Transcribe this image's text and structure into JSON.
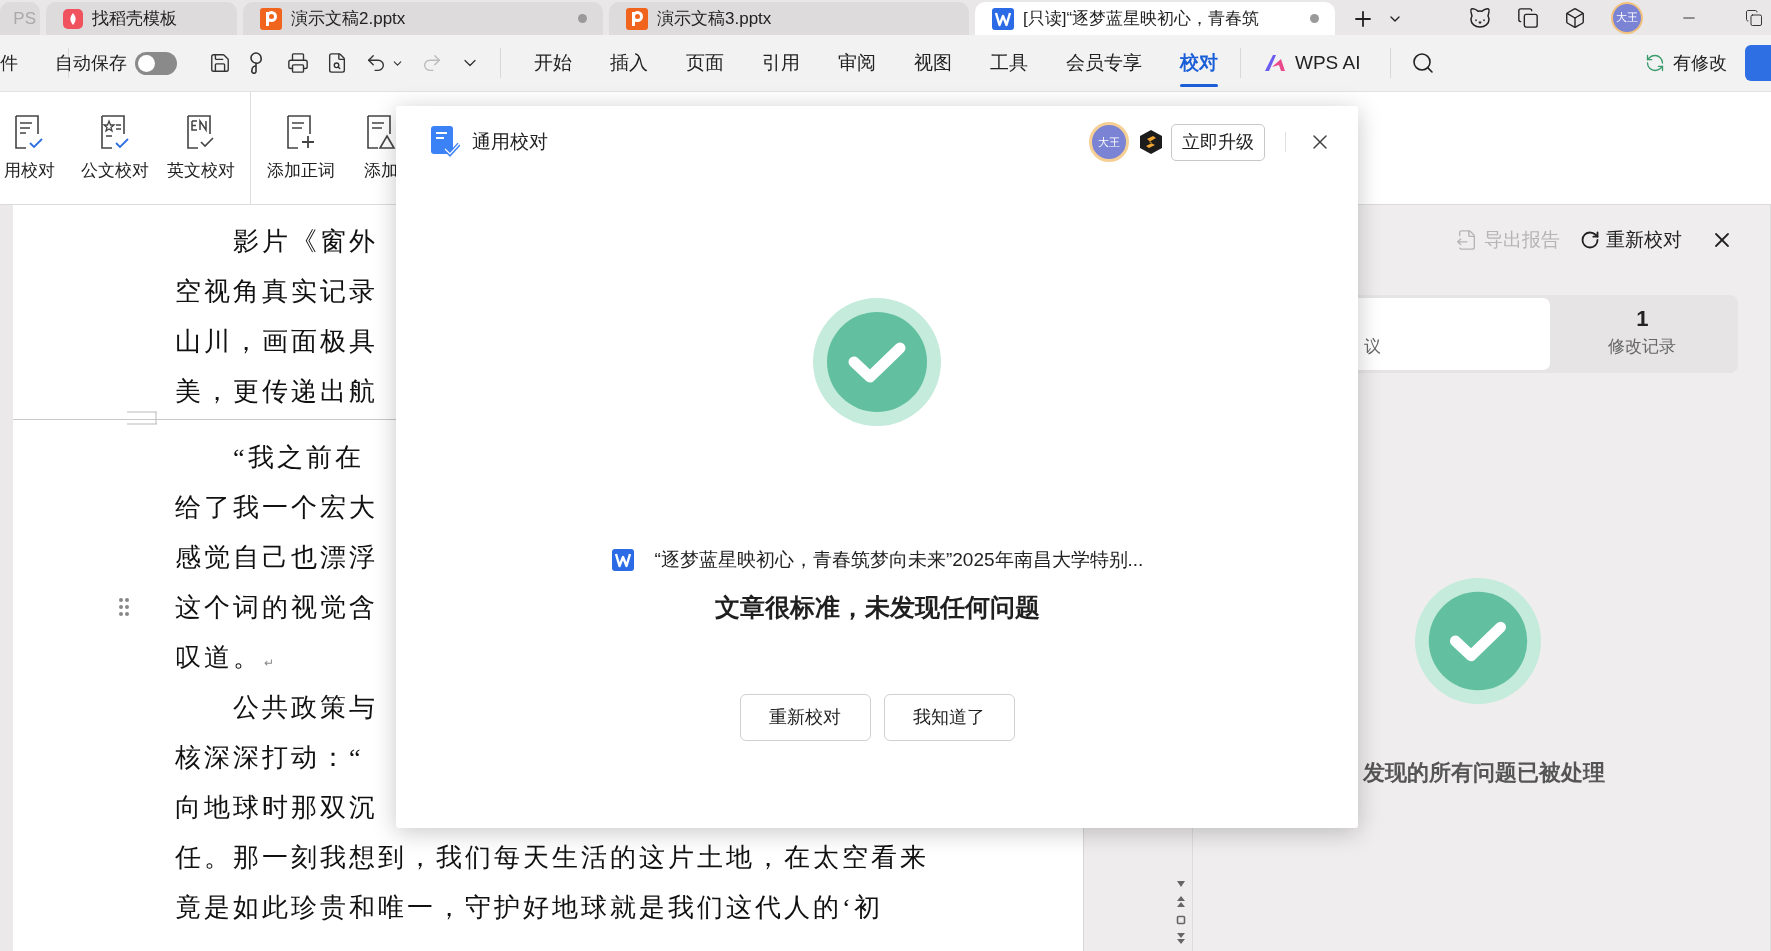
{
  "title_bar": {
    "tabs": [
      {
        "label": "PS",
        "kind": "home",
        "selected": false,
        "unsaved": false
      },
      {
        "label": "找稻壳模板",
        "kind": "template",
        "selected": false,
        "unsaved": false
      },
      {
        "label": "演示文稿2.pptx",
        "kind": "slides",
        "selected": false,
        "unsaved": true
      },
      {
        "label": "演示文稿3.pptx",
        "kind": "slides",
        "selected": false,
        "unsaved": false
      },
      {
        "label": "[只读]“逐梦蓝星映初心，青春筑",
        "kind": "writer",
        "selected": true,
        "unsaved": true
      }
    ],
    "avatar": "大王"
  },
  "toolbar": {
    "file_menu": "件",
    "autosave": {
      "label": "自动保存",
      "on": false
    },
    "menu": [
      {
        "label": "开始",
        "selected": false
      },
      {
        "label": "插入",
        "selected": false
      },
      {
        "label": "页面",
        "selected": false
      },
      {
        "label": "引用",
        "selected": false
      },
      {
        "label": "审阅",
        "selected": false
      },
      {
        "label": "视图",
        "selected": false
      },
      {
        "label": "工具",
        "selected": false
      },
      {
        "label": "会员专享",
        "selected": false
      },
      {
        "label": "校对",
        "selected": true
      }
    ],
    "ai": "WPS AI",
    "changes": "有修改"
  },
  "ribbon": {
    "groups": [
      [
        {
          "label": "用校对",
          "kind": "general"
        },
        {
          "label": "公文校对",
          "kind": "official"
        },
        {
          "label": "英文校对",
          "kind": "english"
        }
      ],
      [
        {
          "label": "添加正词",
          "kind": "add_correct"
        },
        {
          "label": "添加",
          "kind": "add_wrong"
        }
      ]
    ]
  },
  "document": {
    "pages": [
      {
        "paragraphs": [
          {
            "lines": [
              {
                "text": "影片《窗外",
                "handle": false
              },
              {
                "text": "空视角真实记录",
                "handle": false
              },
              {
                "text": "山川，画面极具",
                "handle": false
              },
              {
                "text": "美，更传递出航",
                "handle": false
              }
            ]
          }
        ]
      },
      {
        "paragraphs": [
          {
            "mark": "↵",
            "lines": [
              {
                "text": "“我之前在",
                "handle": false
              },
              {
                "text": "给了我一个宏大",
                "handle": false
              },
              {
                "text": "感觉自己也漂浮",
                "handle": false
              },
              {
                "text": "这个词的视觉含",
                "handle": true
              },
              {
                "text": "叹道。",
                "handle": false
              }
            ]
          },
          {
            "lines": [
              {
                "text": "公共政策与",
                "handle": false
              },
              {
                "text": "核深深打动：“",
                "handle": false
              },
              {
                "text": "向地球时那双沉",
                "handle": false
              },
              {
                "text": "任。那一刻我想到，我们每天生活的这片土地，在太空看来",
                "handle": false
              },
              {
                "text": "竟是如此珍贵和唯一，守护好地球就是我们这代人的‘初",
                "handle": false
              }
            ]
          }
        ]
      }
    ]
  },
  "side_panel": {
    "export": {
      "label": "导出报告",
      "disabled": true
    },
    "recheck": "重新校对",
    "tabs": [
      {
        "label": "议",
        "selected": true
      },
      {
        "count": "1",
        "label": "修改记录",
        "selected": false
      }
    ],
    "status": "发现的所有问题已被处理"
  },
  "dialog": {
    "title": "通用校对",
    "avatar": "大王",
    "upgrade": "立即升级",
    "file_name": "“逐梦蓝星映初心，青春筑梦向未来”2025年南昌大学特别...",
    "message": "文章很标准，未发现任何问题",
    "buttons": [
      "重新校对",
      "我知道了"
    ]
  }
}
